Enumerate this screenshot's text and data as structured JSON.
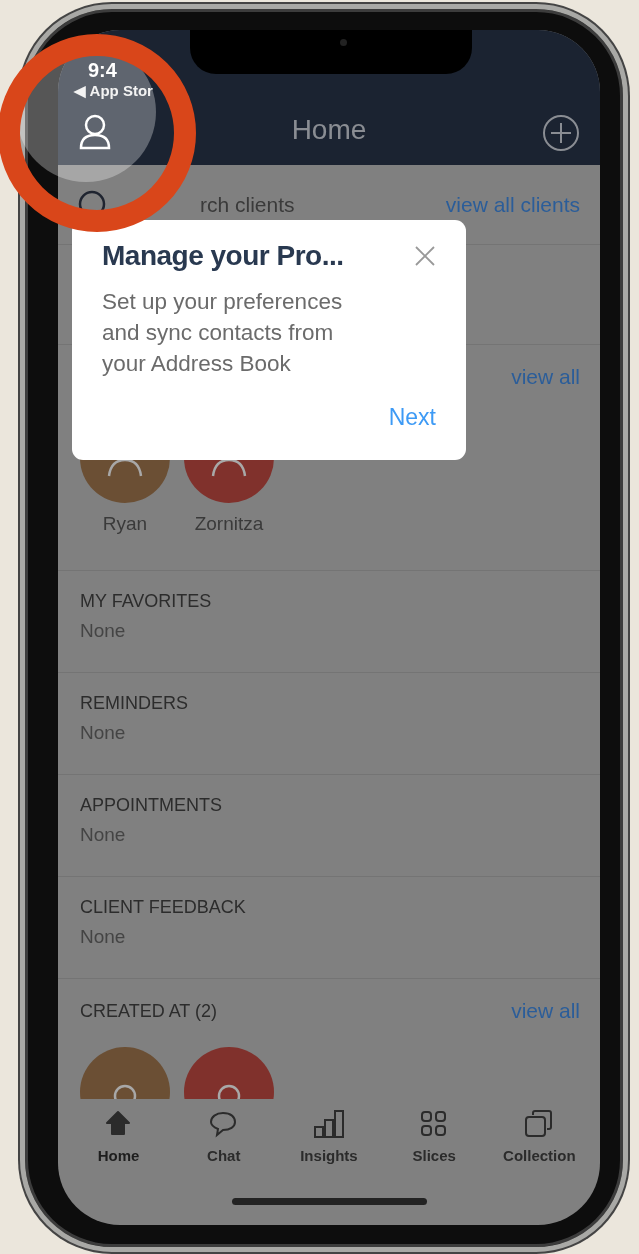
{
  "status_bar": {
    "time": "9:4",
    "back_label": "◀ App Stor"
  },
  "header": {
    "title": "Home"
  },
  "search": {
    "placeholder": "rch clients",
    "link": "view all clients"
  },
  "sections": [
    {
      "kind": "blank"
    },
    {
      "kind": "people",
      "link": "view all",
      "people": [
        {
          "name": "Ryan",
          "color": "#6b4f34"
        },
        {
          "name": "Zornitza",
          "color": "#80312c"
        }
      ]
    },
    {
      "kind": "list",
      "title": "MY FAVORITES",
      "value": "None"
    },
    {
      "kind": "list",
      "title": "REMINDERS",
      "value": "None"
    },
    {
      "kind": "list",
      "title": "APPOINTMENTS",
      "value": "None"
    },
    {
      "kind": "list",
      "title": "CLIENT FEEDBACK",
      "value": "None"
    },
    {
      "kind": "people",
      "title": "CREATED AT (2)",
      "link": "view all",
      "people": [
        {
          "color": "#6b4f34"
        },
        {
          "color": "#80312c"
        }
      ]
    }
  ],
  "popover": {
    "title": "Manage your Pro...",
    "body": "Set up your preferences and sync contacts from your Address Book",
    "action": "Next"
  },
  "tab_bar": [
    {
      "label": "Home",
      "selected": true
    },
    {
      "label": "Chat",
      "selected": false
    },
    {
      "label": "Insights",
      "selected": false
    },
    {
      "label": "Slices",
      "selected": false
    },
    {
      "label": "Collection",
      "selected": false
    }
  ]
}
